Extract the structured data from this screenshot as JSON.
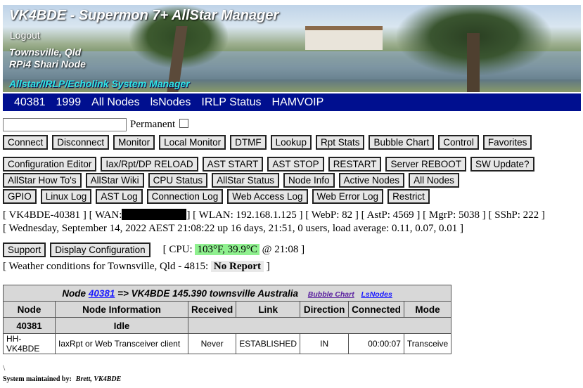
{
  "header": {
    "title": "VK4BDE - Supermon 7+ AllStar Manager",
    "logout": "Logout",
    "location1": "Townsville, Qld",
    "location2": "RPi4 Shari Node",
    "subtitle": "Allstar/IRLP/Echolink System Manager"
  },
  "nav": [
    "40381",
    "1999",
    "All Nodes",
    "lsNodes",
    "IRLP Status",
    "HAMVOIP"
  ],
  "node_input": {
    "value": "",
    "permanent_label": "Permanent"
  },
  "buttons_row1": [
    "Connect",
    "Disconnect",
    "Monitor",
    "Local Monitor",
    "DTMF",
    "Lookup",
    "Rpt Stats",
    "Bubble Chart",
    "Control",
    "Favorites"
  ],
  "buttons_row2": [
    "Configuration Editor",
    "Iax/Rpt/DP RELOAD",
    "AST START",
    "AST STOP",
    "RESTART",
    "Server REBOOT",
    "SW Update?"
  ],
  "buttons_row3": [
    "AllStar How To's",
    "AllStar Wiki",
    "CPU Status",
    "AllStar Status",
    "Node Info",
    "Active Nodes",
    "All Nodes"
  ],
  "buttons_row4": [
    "GPIO",
    "Linux Log",
    "AST Log",
    "Connection Log",
    "Web Access Log",
    "Web Error Log",
    "Restrict"
  ],
  "status": {
    "line1_a": "[ VK4BDE-40381 ] [ WAN:",
    "line1_b": "] [ WLAN: 192.168.1.125 ] [ WebP: 82 ] [ AstP: 4569 ] [ MgrP: 5038 ] [ SShP: 222 ]",
    "line2": "[ Wednesday, September 14, 2022 AEST 21:08:22 up 16 days, 21:51, 0 users, load average: 0.11, 0.07, 0.01 ]"
  },
  "cpu": {
    "support": "Support",
    "display_config": "Display Configuration",
    "prefix": "[ CPU:",
    "temp": "103°F, 39.9°C",
    "suffix": "@ 21:08 ]"
  },
  "weather": {
    "prefix": "[ Weather conditions for Townsville, Qld - 4815:",
    "value": "No Report",
    "suffix": "]"
  },
  "node_table": {
    "title_pre": "Node",
    "node_link": "40381",
    "title_post": "=> VK4BDE 145.390 townsville Australia",
    "bubble_chart": "Bubble Chart",
    "lsnodes": "LsNodes",
    "columns": [
      "Node",
      "Node Information",
      "Received",
      "Link",
      "Direction",
      "Connected",
      "Mode"
    ],
    "idle_row": {
      "node": "40381",
      "info": "Idle"
    },
    "rows": [
      {
        "node": "HH-VK4BDE",
        "info": "IaxRpt or Web Transceiver client",
        "received": "Never",
        "link": "ESTABLISHED",
        "direction": "IN",
        "connected": "00:00:07",
        "mode": "Transceive"
      }
    ]
  },
  "footer": {
    "slash": "\\",
    "maintained_by": "System maintained by:",
    "maintainer": "Brett,   VK4BDE"
  }
}
